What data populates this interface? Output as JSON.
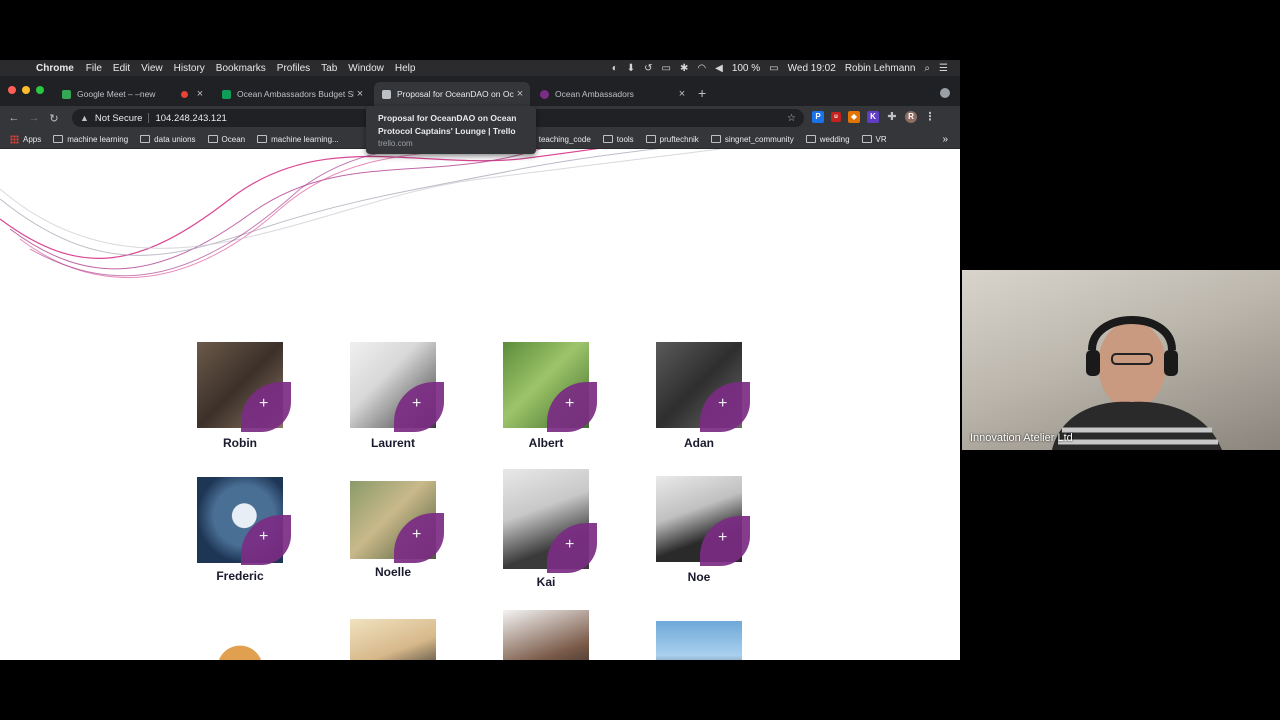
{
  "menubar": {
    "app": "Chrome",
    "menus": [
      "File",
      "Edit",
      "View",
      "History",
      "Bookmarks",
      "Profiles",
      "Tab",
      "Window",
      "Help"
    ],
    "battery": "100 %",
    "datetime": "Wed 19:02",
    "user": "Robin Lehmann"
  },
  "tabs": [
    {
      "title": "Google Meet – –new",
      "active": false,
      "color": "#34a853"
    },
    {
      "title": "Ocean Ambassadors Budget Sh",
      "active": false,
      "color": "#0f9d58"
    },
    {
      "title": "Proposal for OceanDAO on Oc",
      "active": true,
      "color": "#bdc1c6"
    },
    {
      "title": "Ocean Ambassadors",
      "active": false,
      "color": "#7b2c84"
    }
  ],
  "omnibox": {
    "security": "Not Secure",
    "url": "104.248.243.121"
  },
  "bookmarks": [
    "Apps",
    "machine learning",
    "data unions",
    "Ocean",
    "machine learning...",
    "teaching_code",
    "tools",
    "pruftechnik",
    "singnet_community",
    "wedding",
    "VR"
  ],
  "tooltip": {
    "title": "Proposal for OceanDAO on Ocean Protocol Captains' Lounge | Trello",
    "url": "trello.com"
  },
  "ambassadors": [
    {
      "name": "Robin"
    },
    {
      "name": "Laurent"
    },
    {
      "name": "Albert"
    },
    {
      "name": "Adan"
    },
    {
      "name": "Frederic"
    },
    {
      "name": "Noelle"
    },
    {
      "name": "Kai"
    },
    {
      "name": "Noe"
    },
    {
      "name": ""
    },
    {
      "name": ""
    },
    {
      "name": ""
    },
    {
      "name": ""
    }
  ],
  "video": {
    "participant": "Innovation Atelier Ltd"
  },
  "colors": {
    "accent": "#7b2c84",
    "wave_pink": "#d6338a",
    "wave_gray": "#a0a0b0"
  }
}
